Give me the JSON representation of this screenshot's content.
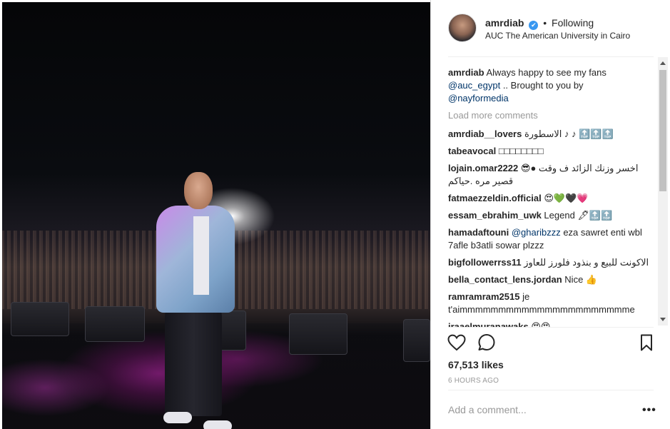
{
  "post": {
    "photo_alt": "Performer on stage in front of crowd"
  },
  "header": {
    "username": "amrdiab",
    "verified_mark": "✔",
    "separator": "•",
    "follow_status": "Following",
    "location": "AUC The American University in Cairo"
  },
  "caption": {
    "user": "amrdiab",
    "text_before": "Always happy to see my fans",
    "mention1": "@auc_egypt",
    "text_middle": " .. Brought to you by",
    "mention2": "@nayformedia"
  },
  "load_more_label": "Load more comments",
  "comments": [
    {
      "user": "amrdiab__lovers",
      "text": "الاسطورة ♪ ♪ 🔝🔝🔝"
    },
    {
      "user": "tabeavocal",
      "text": "□□□□□□□□"
    },
    {
      "user": "lojain.omar2222",
      "text": "اخسر وزنك الزائد ف وقت ●😎 قصير مره .حياكم"
    },
    {
      "user": "fatmaezzeldin.official",
      "text": "😍💚🖤💗"
    },
    {
      "user": "essam_ebrahim_uwk",
      "text": "Legend 🖋🔝🔝"
    },
    {
      "user": "hamadaftouni",
      "mention": "@gharibzzz",
      "text": " eza sawret enti wbl 7afle b3atli sowar plzzz"
    },
    {
      "user": "bigfollowerrss11",
      "text": "الاكونت للبيع و بنذود فلورز للعاوز"
    },
    {
      "user": "bella_contact_lens.jordan",
      "text": "Nice 👍"
    },
    {
      "user": "ramramram2515",
      "text": "je t'aimmmmmmmmmmmmmmmmmmmmmme"
    },
    {
      "user": "jraaelmuranawaks",
      "text": "😍😍"
    }
  ],
  "actions": {
    "like_icon": "heart-outline",
    "comment_icon": "speech-bubble",
    "save_icon": "bookmark"
  },
  "likes_text": "67,513 likes",
  "time_text": "6 HOURS AGO",
  "add_comment_placeholder": "Add a comment...",
  "more_options_label": "•••"
}
